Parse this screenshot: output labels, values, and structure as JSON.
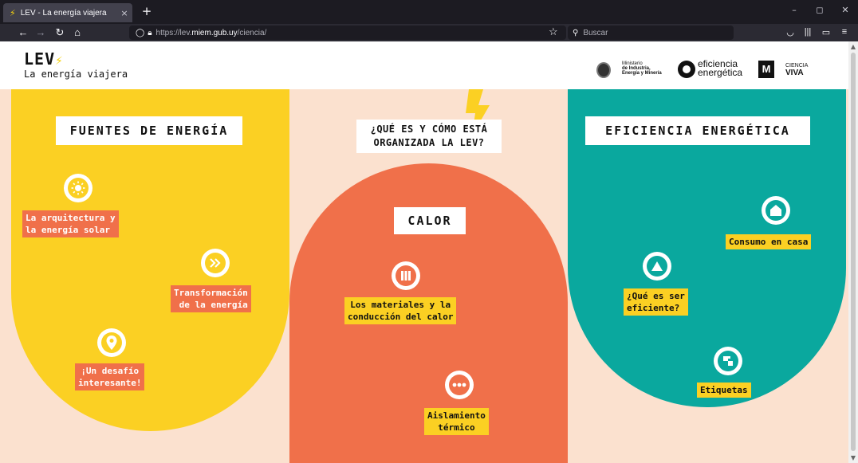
{
  "browser": {
    "tab_title": "LEV - La energía viajera",
    "tab_close": "×",
    "new_tab": "+",
    "url_prefix": "https://lev.",
    "url_host": "miem.gub.uy",
    "url_path": "/ciencia/",
    "search_placeholder": "Buscar",
    "win_min": "–",
    "win_max": "◻",
    "win_close": "✕"
  },
  "header": {
    "brand": "LEV",
    "tagline": "La energía viajera",
    "partners": {
      "ministry_l1": "Ministerio",
      "ministry_l2": "de Industria,",
      "ministry_l3": "Energía y Minería",
      "eficiencia_l1": "eficiencia",
      "eficiencia_l2": "energética",
      "m_logo": "M",
      "ciencia_l1": "CIENCIA",
      "ciencia_l2": "VIVA"
    }
  },
  "colors": {
    "yellow": "#fbd023",
    "orange": "#f0704a",
    "teal": "#0aa89e",
    "peach": "#fbe1cf"
  },
  "sections": {
    "fuentes": {
      "title": "FUENTES DE ENERGÍA",
      "items": [
        {
          "line1": "La arquitectura y",
          "line2": "la energía solar",
          "icon": "sun-icon"
        },
        {
          "line1": "Transformación",
          "line2": "de la energía",
          "icon": "double-chevron-icon"
        },
        {
          "line1": "¡Un desafío",
          "line2": "interesante!",
          "icon": "location-pin-icon"
        }
      ]
    },
    "centro": {
      "title_l1": "¿QUÉ ES Y CÓMO ESTÁ",
      "title_l2": "ORGANIZADA LA LEV?"
    },
    "calor": {
      "title": "CALOR",
      "items": [
        {
          "line1": "Los materiales y la",
          "line2": "conducción del calor",
          "icon": "bars-icon"
        },
        {
          "line1": "Aislamiento",
          "line2": "térmico",
          "icon": "dots-icon"
        }
      ]
    },
    "eficiencia": {
      "title": "EFICIENCIA ENERGÉTICA",
      "items": [
        {
          "line1": "Consumo en casa",
          "icon": "house-icon"
        },
        {
          "line1": "¿Qué es ser",
          "line2": "eficiente?",
          "icon": "triangle-icon"
        },
        {
          "line1": "Etiquetas",
          "icon": "squares-icon"
        }
      ]
    }
  }
}
